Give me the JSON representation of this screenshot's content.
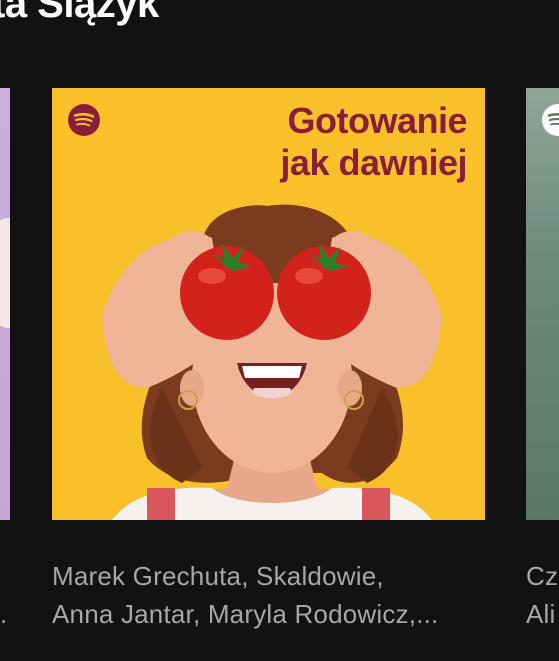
{
  "section": {
    "title": "ta Ślązyk"
  },
  "cards": {
    "left": {
      "description_line2": "."
    },
    "main": {
      "cover_title_line1": "Gotowanie",
      "cover_title_line2": "jak dawniej",
      "logo_icon": "spotify-logo-icon",
      "description_line1": "Marek Grechuta, Skaldowie,",
      "description_line2": "Anna Jantar, Maryla Rodowicz,..."
    },
    "right": {
      "logo_icon": "spotify-logo-icon",
      "description_line1": "Cz",
      "description_line2": "Ali"
    }
  },
  "colors": {
    "background": "#121212",
    "cover_yellow": "#f8c12a",
    "cover_title": "#8a1d3a",
    "description_text": "#a7a7a7"
  }
}
